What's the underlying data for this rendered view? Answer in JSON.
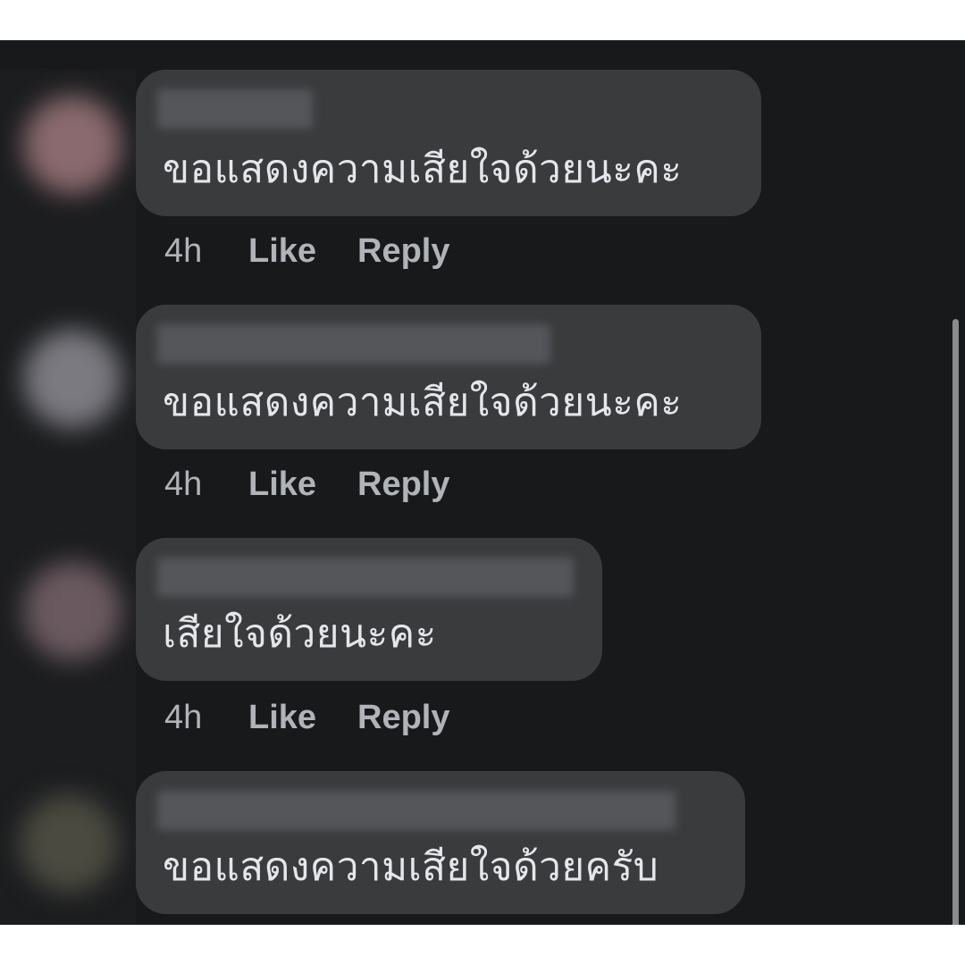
{
  "comments": [
    {
      "text": "ขอแสดงความเสียใจด้วยนะคะ",
      "time": "4h",
      "like_label": "Like",
      "reply_label": "Reply"
    },
    {
      "text": "ขอแสดงความเสียใจด้วยนะคะ",
      "time": "4h",
      "like_label": "Like",
      "reply_label": "Reply"
    },
    {
      "text": "เสียใจด้วยนะคะ",
      "time": "4h",
      "like_label": "Like",
      "reply_label": "Reply"
    },
    {
      "text": "ขอแสดงความเสียใจด้วยครับ"
    }
  ]
}
